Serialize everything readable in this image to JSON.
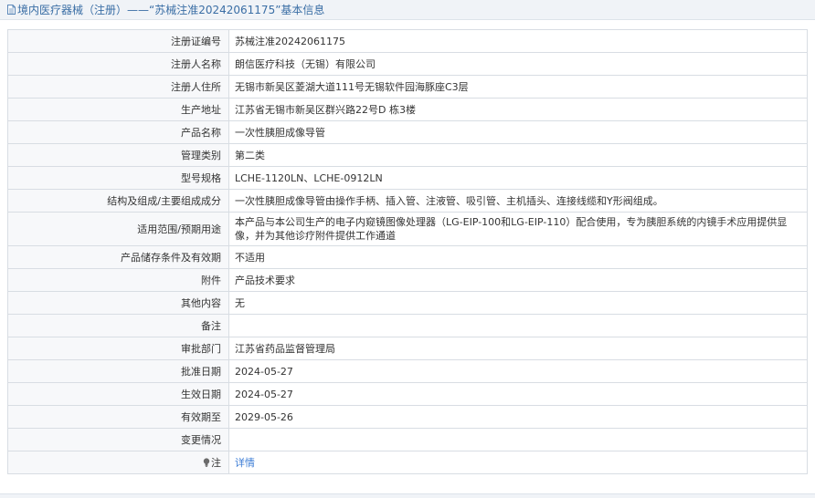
{
  "header": {
    "title": "境内医疗器械（注册）——“苏械注准20242061175”基本信息",
    "icon": "document-icon"
  },
  "rows": [
    {
      "label": "注册证编号",
      "value": "苏械注准20242061175"
    },
    {
      "label": "注册人名称",
      "value": "朗信医疗科技（无锡）有限公司"
    },
    {
      "label": "注册人住所",
      "value": "无锡市新吴区菱湖大道111号无锡软件园海豚座C3层"
    },
    {
      "label": "生产地址",
      "value": "江苏省无锡市新吴区群兴路22号D 栋3楼"
    },
    {
      "label": "产品名称",
      "value": "一次性胰胆成像导管"
    },
    {
      "label": "管理类别",
      "value": "第二类"
    },
    {
      "label": "型号规格",
      "value": "LCHE-1120LN、LCHE-0912LN"
    },
    {
      "label": "结构及组成/主要组成成分",
      "value": "一次性胰胆成像导管由操作手柄、插入管、注液管、吸引管、主机插头、连接线缆和Y形阀组成。"
    },
    {
      "label": "适用范围/预期用途",
      "value": "本产品与本公司生产的电子内窥镜图像处理器（LG-EIP-100和LG-EIP-110）配合使用，专为胰胆系统的内镜手术应用提供显像，并为其他诊疗附件提供工作通道"
    },
    {
      "label": "产品储存条件及有效期",
      "value": "不适用"
    },
    {
      "label": "附件",
      "value": "产品技术要求"
    },
    {
      "label": "其他内容",
      "value": "无"
    },
    {
      "label": "备注",
      "value": ""
    },
    {
      "label": "审批部门",
      "value": "江苏省药品监督管理局"
    },
    {
      "label": "批准日期",
      "value": "2024-05-27"
    },
    {
      "label": "生效日期",
      "value": "2024-05-27"
    },
    {
      "label": "有效期至",
      "value": "2029-05-26"
    },
    {
      "label": "变更情况",
      "value": ""
    }
  ],
  "note_row": {
    "label": "注",
    "icon": "lightbulb-icon",
    "link_text": "详情"
  },
  "colors": {
    "header_text": "#3a6ea5",
    "link": "#3a7bd5",
    "border": "#d8dde3",
    "label_bg": "#f7f8fa"
  }
}
